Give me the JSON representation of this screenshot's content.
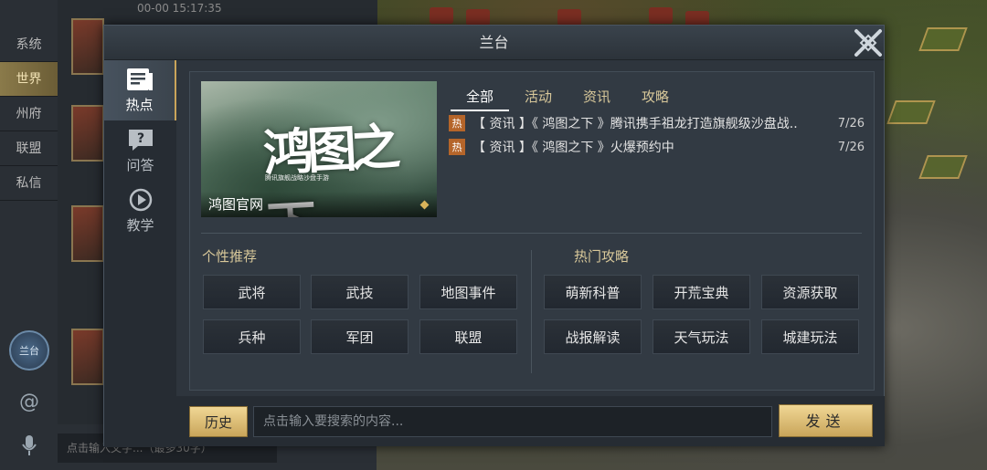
{
  "background": {
    "chat_tabs": [
      "系统",
      "世界",
      "州府",
      "联盟",
      "私信"
    ],
    "chat_active_tab": "世界",
    "chat_timestamp": "00-00 15:17:35",
    "chat_input_placeholder": "点击输入文字...（最多30字）",
    "chat_send_label": "发送",
    "lantai_logo_text": "兰台",
    "at_icon": "@"
  },
  "dialog": {
    "title": "兰台",
    "nav": [
      {
        "label": "热点",
        "icon": "news-icon"
      },
      {
        "label": "问答",
        "icon": "question-icon"
      },
      {
        "label": "教学",
        "icon": "play-icon"
      }
    ],
    "banner": {
      "calligraphy": "鸿图之下",
      "subtitle": "腾讯旗舰战略沙盘手游",
      "label": "鸿图官网"
    },
    "news_tabs": [
      "全部",
      "活动",
      "资讯",
      "攻略"
    ],
    "news": [
      {
        "badge": "热",
        "text": "【 资讯 】《 鸿图之下 》腾讯携手祖龙打造旗舰级沙盘战..",
        "date": "7/26"
      },
      {
        "badge": "热",
        "text": "【 资讯 】《 鸿图之下 》火爆预约中",
        "date": "7/26"
      }
    ],
    "personal": {
      "title": "个性推荐",
      "tags": [
        "武将",
        "武技",
        "地图事件",
        "兵种",
        "军团",
        "联盟"
      ]
    },
    "hot_guides": {
      "title": "热门攻略",
      "tags": [
        "萌新科普",
        "开荒宝典",
        "资源获取",
        "战报解读",
        "天气玩法",
        "城建玩法"
      ]
    },
    "history_label": "历史",
    "search_placeholder": "点击输入要搜索的内容...",
    "send_label": "发送"
  },
  "colors": {
    "accent_gold": "#d8c89a",
    "button_gold": "#e2c27a",
    "hot_badge": "#b5652a"
  }
}
